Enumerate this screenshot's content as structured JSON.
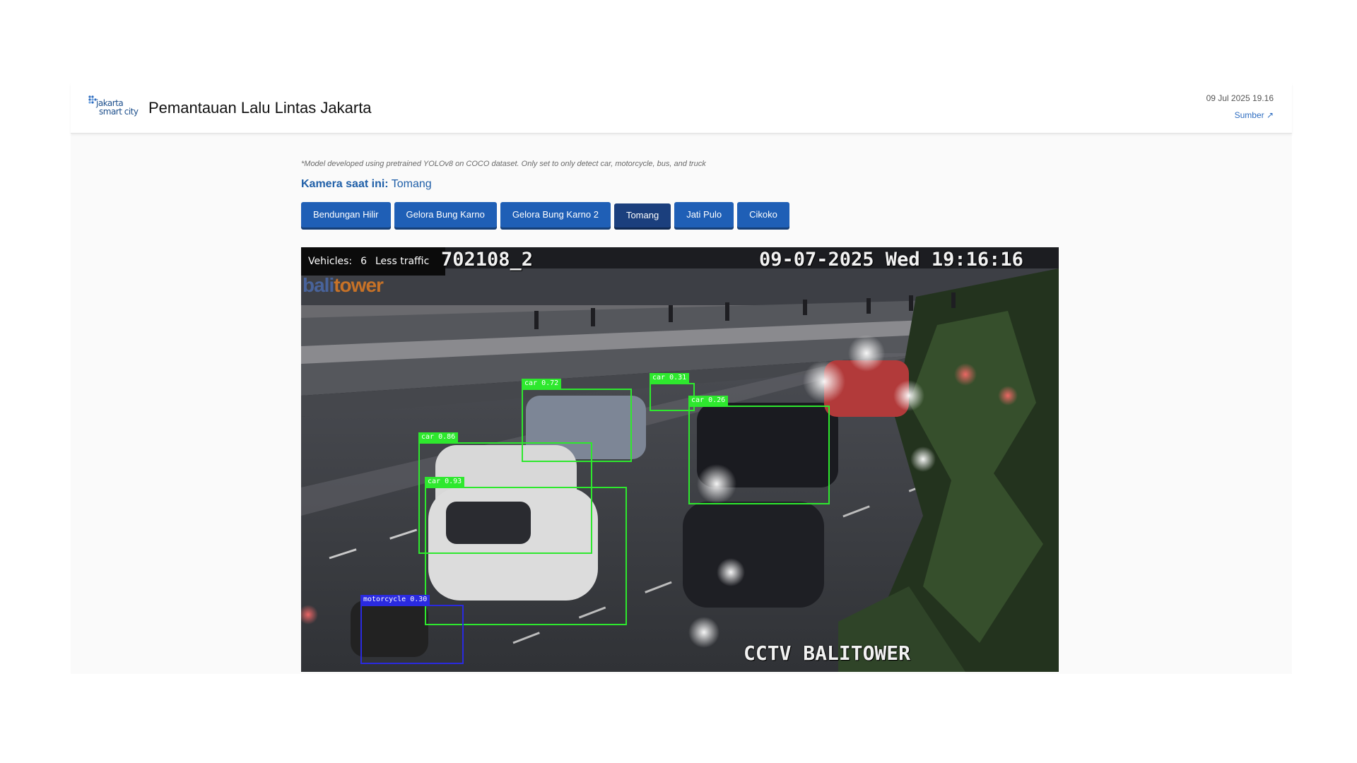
{
  "header": {
    "logo_line1": "jakarta",
    "logo_line2": "smart city",
    "title": "Pemantauan Lalu Lintas Jakarta",
    "timestamp": "09 Jul 2025 19.16",
    "source_link": "Sumber ↗"
  },
  "main": {
    "model_note": "*Model developed using pretrained YOLOv8 on COCO dataset. Only set to only detect car, motorcycle, bus, and truck",
    "camera_label": "Kamera saat ini:",
    "camera_value": "Tomang",
    "camera_buttons": [
      {
        "label": "Bendungan Hilir",
        "active": false
      },
      {
        "label": "Gelora Bung Karno",
        "active": false
      },
      {
        "label": "Gelora Bung Karno 2",
        "active": false
      },
      {
        "label": "Tomang",
        "active": true
      },
      {
        "label": "Jati Pulo",
        "active": false
      },
      {
        "label": "Cikoko",
        "active": false
      }
    ]
  },
  "feed": {
    "vehicles_label": "Vehicles:",
    "vehicles_count": "6",
    "traffic_status": "Less traffic",
    "cam_id": "702108_2",
    "osd_datetime": "09-07-2025 Wed 19:16:16",
    "watermark_a": "bali",
    "watermark_b": "tower",
    "osd_brand": "CCTV BALITOWER",
    "detections": [
      {
        "label": "car 0.72",
        "cls": "car"
      },
      {
        "label": "car 0.31",
        "cls": "car"
      },
      {
        "label": "car 0.26",
        "cls": "car"
      },
      {
        "label": "car 0.86",
        "cls": "car"
      },
      {
        "label": "car 0.93",
        "cls": "car"
      },
      {
        "label": "motorcycle 0.30",
        "cls": "motorcycle"
      }
    ],
    "colors": {
      "car_box": "#2ee82e",
      "motorcycle_box": "#2a2ae0"
    }
  }
}
